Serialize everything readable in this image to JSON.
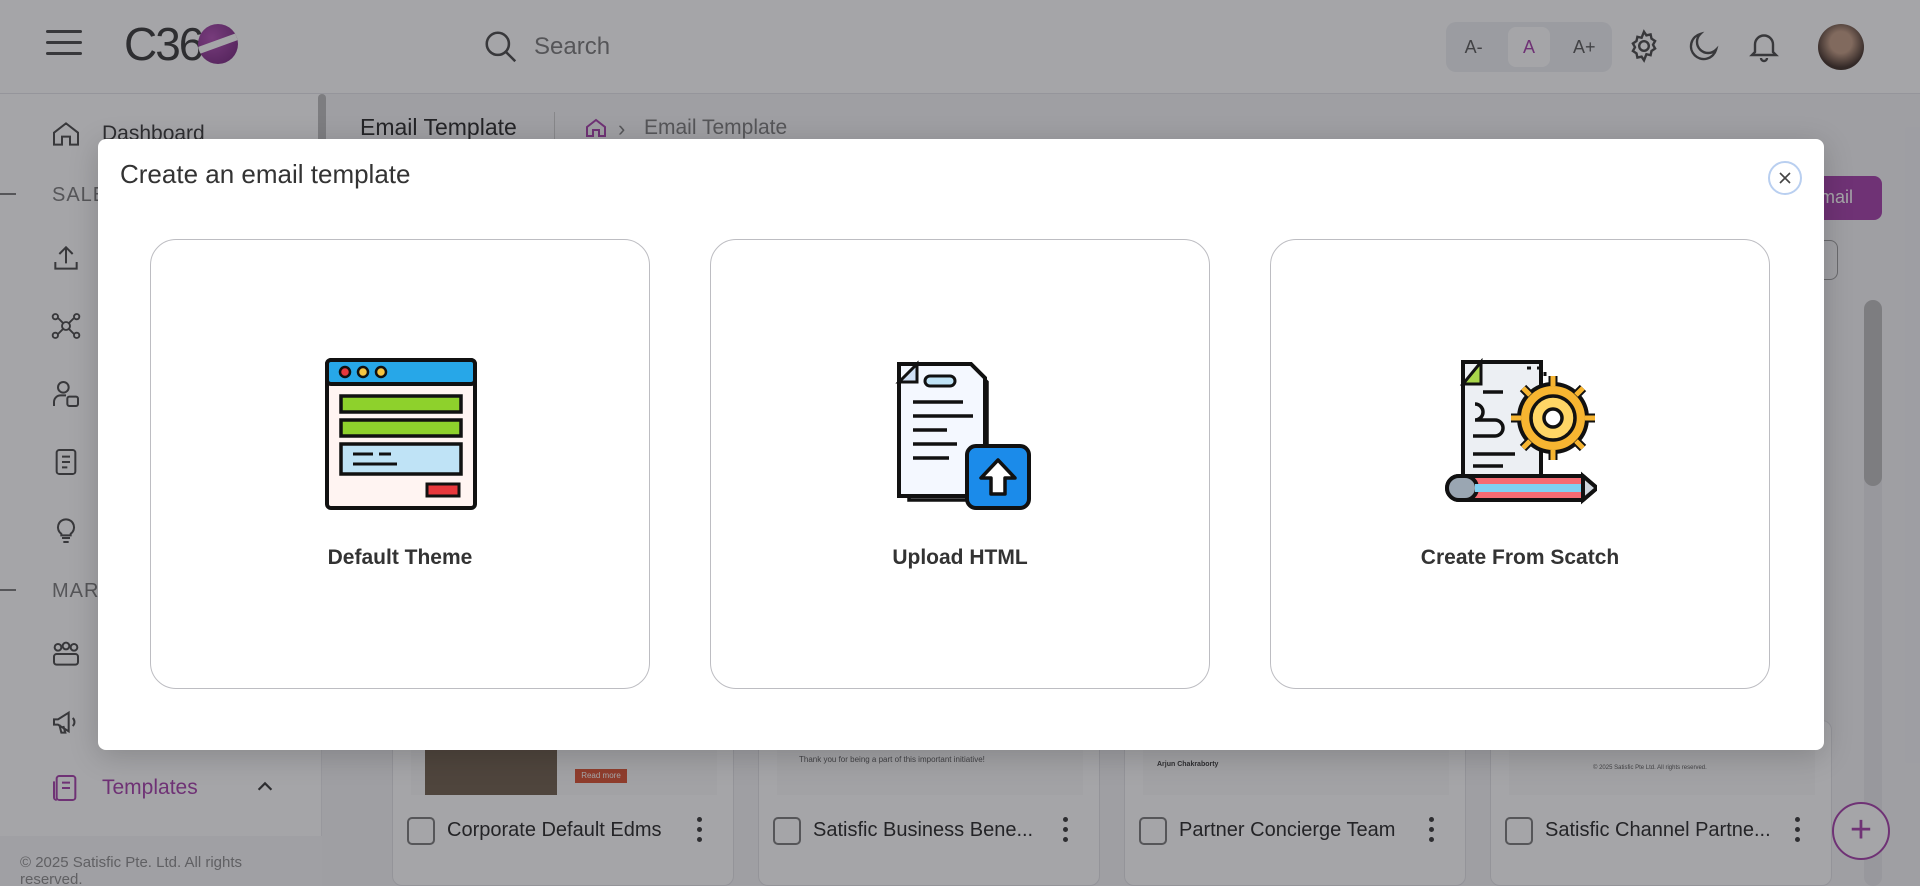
{
  "header": {
    "logo_text": "C36",
    "search_placeholder": "Search",
    "font_small": "A-",
    "font_normal": "A",
    "font_large": "A+"
  },
  "sidebar": {
    "items": [
      {
        "label": "Dashboard",
        "icon": "home-icon"
      },
      {
        "label": "",
        "icon": "upload-icon"
      },
      {
        "label": "",
        "icon": "network-icon"
      },
      {
        "label": "",
        "icon": "user-group-icon"
      },
      {
        "label": "",
        "icon": "document-icon"
      },
      {
        "label": "",
        "icon": "lightbulb-icon"
      },
      {
        "label": "",
        "icon": "team-icon"
      },
      {
        "label": "",
        "icon": "megaphone-icon"
      },
      {
        "label": "Templates",
        "icon": "template-icon"
      }
    ],
    "section_sales": "SALE",
    "section_marketing": "MAR",
    "copyright": "© 2025 Satisfic Pte. Ltd. All rights reserved."
  },
  "page": {
    "title": "Email Template",
    "breadcrumb_current": "Email Template",
    "add_button_label": "mail"
  },
  "cards": [
    {
      "title": "Corporate Default Edms",
      "thumb_caption": "Read more"
    },
    {
      "title": "Satisfic Business Bene...",
      "thumb_caption": "Thank you for being a part of this important initiative!"
    },
    {
      "title": "Partner Concierge Team",
      "thumb_caption": "Arjun Chakraborty"
    },
    {
      "title": "Satisfic Channel Partne...",
      "thumb_caption": "© 2025 Satisfic Pte Ltd. All rights reserved."
    }
  ],
  "modal": {
    "title": "Create an email template",
    "options": [
      {
        "label": "Default Theme",
        "icon": "browser-template-icon"
      },
      {
        "label": "Upload HTML",
        "icon": "document-upload-icon"
      },
      {
        "label": "Create From Scatch",
        "icon": "document-gear-pencil-icon"
      }
    ]
  },
  "colors": {
    "accent": "#a33aa8",
    "overlay": "rgba(40,40,48,0.42)"
  }
}
